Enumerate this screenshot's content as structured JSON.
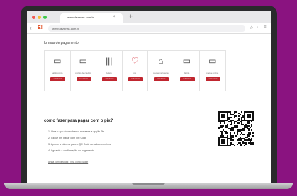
{
  "browser": {
    "tab_title": "www.dezenas.com.br",
    "tab_close": "×",
    "new_tab": "+",
    "url": "www.dezenas.com.br",
    "logo": "E!"
  },
  "page": {
    "section_title": "formas de pagamento",
    "methods": [
      {
        "icon": "boleto-card-icon",
        "glyph": "▭",
        "label": "saldo conta",
        "button": "selecionar",
        "featured": false
      },
      {
        "icon": "credit-card-icon",
        "glyph": "▭",
        "label": "cartão de crédito",
        "button": "selecionar",
        "featured": false
      },
      {
        "icon": "barcode-icon",
        "glyph": "|||",
        "label": "boleto",
        "button": "selecionar",
        "featured": false
      },
      {
        "icon": "heart-icon",
        "glyph": "♡",
        "label": "pix",
        "button": "selecionar",
        "featured": true
      },
      {
        "icon": "house-icon",
        "glyph": "⌂",
        "label": "pague na loteria",
        "button": "selecionar",
        "featured": false
      },
      {
        "icon": "card-icon",
        "glyph": "▭",
        "label": "débito",
        "button": "selecionar",
        "featured": false
      },
      {
        "icon": "wallet-icon",
        "glyph": "▭",
        "label": "pague online",
        "button": "selecionar",
        "featured": false
      }
    ],
    "how_title": "como fazer para pagar com o pix?",
    "steps": [
      "1. Abra o app do seu banco e acesse a opção Pix",
      "2. Clique em pagar com QR Code",
      "3. Aponte a câmera para o QR Code ao lado e confirme",
      "4. Aguarde a confirmação do pagamento"
    ],
    "help_link": "ainda com dúvidas? veja como pagar"
  },
  "colors": {
    "background": "#8a1380",
    "accent": "#c0262f"
  }
}
